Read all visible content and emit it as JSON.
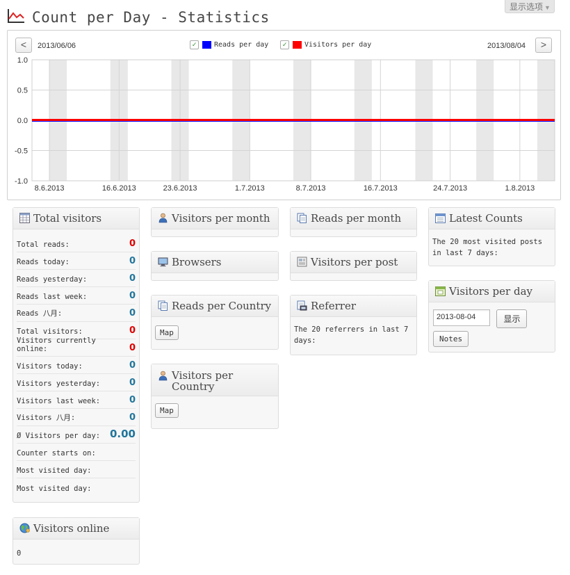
{
  "header": {
    "title": "Count per Day - Statistics",
    "screen_options": "显示选项"
  },
  "chart_nav": {
    "start_date": "2013/06/06",
    "end_date": "2013/08/04",
    "prev_label": "<",
    "next_label": ">"
  },
  "legend": {
    "reads": "Reads per day",
    "visitors": "Visitors per day",
    "check": "✓"
  },
  "colors": {
    "reads": "#0000ff",
    "visitors": "#ff0000",
    "band": "#e8e8e8",
    "grid": "#d4d4d4"
  },
  "chart_data": {
    "type": "line",
    "x_start": "2013-06-06",
    "x_end": "2013-08-04",
    "ylim": [
      -1.0,
      1.0
    ],
    "y_ticks": [
      "1.0",
      "0.5",
      "0.0",
      "-0.5",
      "-1.0"
    ],
    "x_ticks": [
      {
        "date": "2013-06-08",
        "label": "8.6.2013"
      },
      {
        "date": "2013-06-16",
        "label": "16.6.2013"
      },
      {
        "date": "2013-06-23",
        "label": "23.6.2013"
      },
      {
        "date": "2013-07-01",
        "label": "1.7.2013"
      },
      {
        "date": "2013-07-08",
        "label": "8.7.2013"
      },
      {
        "date": "2013-07-16",
        "label": "16.7.2013"
      },
      {
        "date": "2013-07-24",
        "label": "24.7.2013"
      },
      {
        "date": "2013-08-01",
        "label": "1.8.2013"
      }
    ],
    "weekend_bands": [
      "2013-06-08",
      "2013-06-15",
      "2013-06-22",
      "2013-06-29",
      "2013-07-06",
      "2013-07-13",
      "2013-07-20",
      "2013-07-27",
      "2013-08-03"
    ],
    "series": [
      {
        "name": "Reads per day",
        "color": "#0000ff",
        "values": [
          0,
          0
        ]
      },
      {
        "name": "Visitors per day",
        "color": "#ff0000",
        "values": [
          0,
          0
        ]
      }
    ],
    "grid": true
  },
  "total_visitors": {
    "title": "Total visitors",
    "rows": [
      {
        "label": "Total reads:",
        "value": "0",
        "color": "red"
      },
      {
        "label": "Reads today:",
        "value": "0",
        "color": "blue"
      },
      {
        "label": "Reads yesterday:",
        "value": "0",
        "color": "blue"
      },
      {
        "label": "Reads last week:",
        "value": "0",
        "color": "blue"
      },
      {
        "label": "Reads 八月:",
        "value": "0",
        "color": "blue"
      },
      {
        "label": "Total visitors:",
        "value": "0",
        "color": "red"
      },
      {
        "label": "Visitors currently online:",
        "value": "0",
        "color": "red"
      },
      {
        "label": "Visitors today:",
        "value": "0",
        "color": "blue"
      },
      {
        "label": "Visitors yesterday:",
        "value": "0",
        "color": "blue"
      },
      {
        "label": "Visitors last week:",
        "value": "0",
        "color": "blue"
      },
      {
        "label": "Visitors 八月:",
        "value": "0",
        "color": "blue"
      },
      {
        "label": "Ø Visitors per day:",
        "value": "0.00",
        "color": "blue"
      },
      {
        "label": "Counter starts on:",
        "value": "",
        "color": "blue"
      },
      {
        "label": "Most visited day:",
        "value": "",
        "color": "blue"
      },
      {
        "label": "Most visited day:",
        "value": "",
        "color": "blue"
      }
    ]
  },
  "visitors_online": {
    "title": "Visitors online",
    "value": "0"
  },
  "visitors_per_month": {
    "title": "Visitors per month"
  },
  "browsers": {
    "title": "Browsers"
  },
  "reads_per_country": {
    "title": "Reads per Country",
    "button": "Map"
  },
  "visitors_per_country": {
    "title": "Visitors per Country",
    "button": "Map"
  },
  "reads_per_month": {
    "title": "Reads per month"
  },
  "visitors_per_post": {
    "title": "Visitors per post"
  },
  "referrer": {
    "title": "Referrer",
    "text": "The 20 referrers in last 7 days:"
  },
  "latest_counts": {
    "title": "Latest Counts",
    "text": "The 20 most visited posts in last 7 days:"
  },
  "visitors_per_day": {
    "title": "Visitors per day",
    "date_value": "2013-08-04",
    "show_button": "显示",
    "notes_button": "Notes"
  }
}
